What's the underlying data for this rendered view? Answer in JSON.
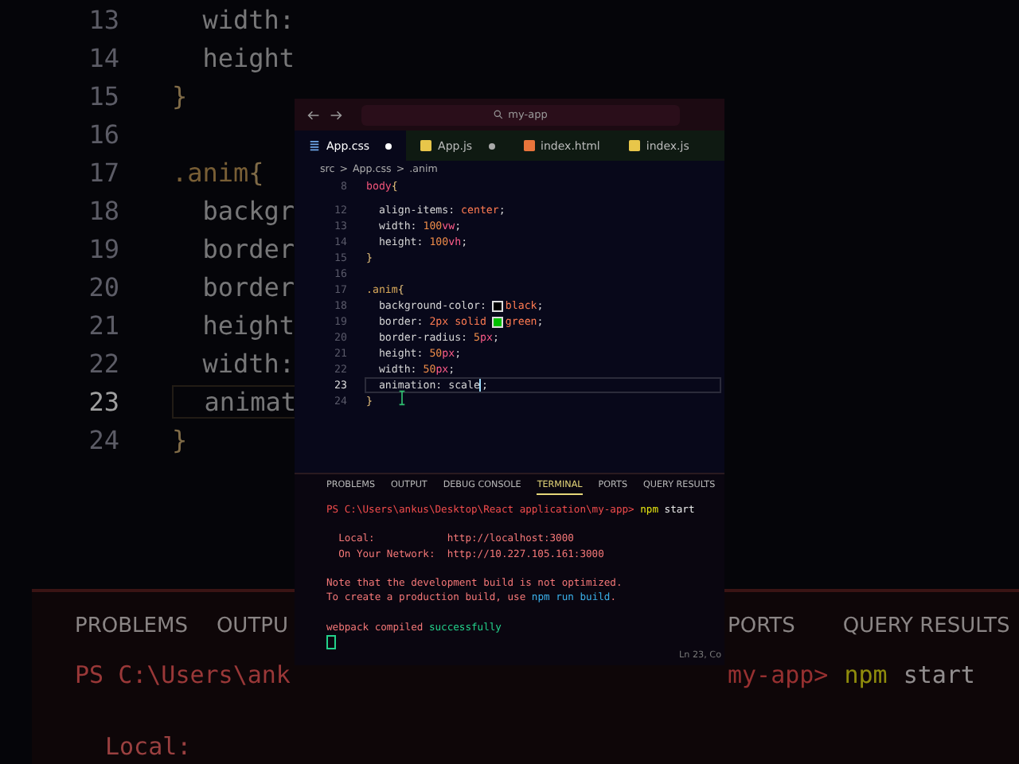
{
  "backdrop": {
    "code_lines": [
      {
        "number": "13",
        "current": false,
        "tokens": [
          {
            "text": "  width:",
            "kind": "prop"
          }
        ]
      },
      {
        "number": "14",
        "current": false,
        "tokens": [
          {
            "text": "  height",
            "kind": "prop"
          }
        ]
      },
      {
        "number": "15",
        "current": false,
        "tokens": [
          {
            "text": "}",
            "kind": "brace"
          }
        ]
      },
      {
        "number": "16",
        "current": false
      },
      {
        "number": "17",
        "current": false,
        "tokens": [
          {
            "text": ".anim",
            "kind": "sel"
          },
          {
            "text": "{",
            "kind": "brace"
          }
        ]
      },
      {
        "number": "18",
        "current": false,
        "tokens": [
          {
            "text": "  backgr",
            "kind": "prop"
          }
        ]
      },
      {
        "number": "19",
        "current": false,
        "tokens": [
          {
            "text": "  border",
            "kind": "prop"
          }
        ]
      },
      {
        "number": "20",
        "current": false,
        "tokens": [
          {
            "text": "  border",
            "kind": "prop"
          }
        ]
      },
      {
        "number": "21",
        "current": false,
        "tokens": [
          {
            "text": "  height",
            "kind": "prop"
          }
        ]
      },
      {
        "number": "22",
        "current": false,
        "tokens": [
          {
            "text": "  width:",
            "kind": "prop"
          }
        ]
      },
      {
        "number": "23",
        "current": true,
        "tokens": [
          {
            "text": "  animat",
            "kind": "prop"
          }
        ]
      },
      {
        "number": "24",
        "current": false,
        "tokens": [
          {
            "text": "}",
            "kind": "brace"
          }
        ]
      }
    ],
    "panel": {
      "tabs_left": [
        "PROBLEMS",
        "OUTPU"
      ],
      "tabs_right": [
        "PORTS",
        "QUERY RESULTS"
      ],
      "prompt_left": "PS C:\\Users\\ank",
      "prompt_right": [
        {
          "text": "my-app>",
          "kind": "path"
        },
        {
          "text": "npm",
          "kind": "cmd"
        },
        {
          "text": "start",
          "kind": "arg"
        }
      ],
      "local": "Local:"
    }
  },
  "window": {
    "search": "my-app",
    "tabs": [
      {
        "label": "App.css",
        "kind": "css",
        "selected": true,
        "modified": true
      },
      {
        "label": "App.js",
        "kind": "js",
        "selected": false,
        "modified": true
      },
      {
        "label": "index.html",
        "kind": "html",
        "selected": false,
        "modified": false
      },
      {
        "label": "index.js",
        "kind": "js",
        "selected": false,
        "modified": false
      }
    ],
    "breadcrumb": [
      {
        "kind": "item",
        "text": "src"
      },
      {
        "kind": "separator",
        "text": ">"
      },
      {
        "kind": "item",
        "text": "App.css"
      },
      {
        "kind": "separator",
        "text": ">"
      },
      {
        "kind": "item",
        "text": ".anim"
      }
    ],
    "editor_lines": [
      {
        "number": "8",
        "current": false,
        "tokens": [
          {
            "text": "body",
            "kind": "tag"
          },
          {
            "text": "{",
            "kind": "brace"
          }
        ]
      },
      {
        "number": "12",
        "current": false,
        "tokens": [
          {
            "text": "  align-items: ",
            "kind": "prop"
          },
          {
            "text": "center",
            "kind": "val"
          },
          {
            "text": ";",
            "kind": "prop"
          }
        ]
      },
      {
        "number": "13",
        "current": false,
        "tokens": [
          {
            "text": "  width: ",
            "kind": "prop"
          },
          {
            "text": "100",
            "kind": "num"
          },
          {
            "text": "vw",
            "kind": "unit"
          },
          {
            "text": ";",
            "kind": "prop"
          }
        ]
      },
      {
        "number": "14",
        "current": false,
        "tokens": [
          {
            "text": "  height: ",
            "kind": "prop"
          },
          {
            "text": "100",
            "kind": "num"
          },
          {
            "text": "vh",
            "kind": "unit"
          },
          {
            "text": ";",
            "kind": "prop"
          }
        ]
      },
      {
        "number": "15",
        "current": false,
        "tokens": [
          {
            "text": "}",
            "kind": "brace"
          }
        ]
      },
      {
        "number": "16",
        "current": false
      },
      {
        "number": "17",
        "current": false,
        "tokens": [
          {
            "text": ".anim",
            "kind": "sel"
          },
          {
            "text": "{",
            "kind": "brace"
          }
        ]
      },
      {
        "number": "18",
        "current": false,
        "tokens": [
          {
            "text": "  background-color: ",
            "kind": "prop"
          },
          {
            "kind": "swatch",
            "color": "#000000"
          },
          {
            "text": "black",
            "kind": "val"
          },
          {
            "text": ";",
            "kind": "prop"
          }
        ]
      },
      {
        "number": "19",
        "current": false,
        "tokens": [
          {
            "text": "  border: ",
            "kind": "prop"
          },
          {
            "text": "2px solid ",
            "kind": "val"
          },
          {
            "kind": "swatch",
            "color": "#00c000"
          },
          {
            "text": "green",
            "kind": "val"
          },
          {
            "text": ";",
            "kind": "prop"
          }
        ]
      },
      {
        "number": "20",
        "current": false,
        "tokens": [
          {
            "text": "  border-radius: ",
            "kind": "prop"
          },
          {
            "text": "5",
            "kind": "num"
          },
          {
            "text": "px",
            "kind": "unit"
          },
          {
            "text": ";",
            "kind": "prop"
          }
        ]
      },
      {
        "number": "21",
        "current": false,
        "tokens": [
          {
            "text": "  height: ",
            "kind": "prop"
          },
          {
            "text": "50",
            "kind": "num"
          },
          {
            "text": "px",
            "kind": "unit"
          },
          {
            "text": ";",
            "kind": "prop"
          }
        ]
      },
      {
        "number": "22",
        "current": false,
        "tokens": [
          {
            "text": "  width: ",
            "kind": "prop"
          },
          {
            "text": "50",
            "kind": "num"
          },
          {
            "text": "px",
            "kind": "unit"
          },
          {
            "text": ";",
            "kind": "prop"
          }
        ]
      },
      {
        "number": "23",
        "current": true,
        "tokens": [
          {
            "text": "  animation: scale",
            "kind": "prop"
          },
          {
            "kind": "caret"
          },
          {
            "text": ";",
            "kind": "prop"
          }
        ]
      },
      {
        "number": "24",
        "current": false,
        "tokens": [
          {
            "text": "}",
            "kind": "brace"
          }
        ]
      }
    ],
    "panel": {
      "tabs": [
        {
          "label": "PROBLEMS",
          "selected": false
        },
        {
          "label": "OUTPUT",
          "selected": false
        },
        {
          "label": "DEBUG CONSOLE",
          "selected": false
        },
        {
          "label": "TERMINAL",
          "selected": true
        },
        {
          "label": "PORTS",
          "selected": false
        },
        {
          "label": "QUERY RESULTS",
          "selected": false
        }
      ],
      "terminal_lines": [
        {
          "kind": "text",
          "segments": [
            {
              "text": "PS C:\\Users\\ankus\\Desktop\\React application\\my-app> ",
              "kind": "path"
            },
            {
              "text": "npm",
              "kind": "cmd"
            },
            {
              "text": " start",
              "kind": "arg"
            }
          ]
        },
        {
          "kind": "blank"
        },
        {
          "kind": "text",
          "segments": [
            {
              "text": "  Local:            http://localhost:3000",
              "kind": "err"
            }
          ]
        },
        {
          "kind": "text",
          "segments": [
            {
              "text": "  On Your Network:  http://10.227.105.161:3000",
              "kind": "err"
            }
          ]
        },
        {
          "kind": "blank"
        },
        {
          "kind": "text",
          "segments": [
            {
              "text": "Note that the development build is not optimized.",
              "kind": "err"
            }
          ]
        },
        {
          "kind": "text",
          "segments": [
            {
              "text": "To create a production build, use ",
              "kind": "err"
            },
            {
              "text": "npm run build",
              "kind": "link"
            },
            {
              "text": ".",
              "kind": "err"
            }
          ]
        },
        {
          "kind": "blank"
        },
        {
          "kind": "text",
          "segments": [
            {
              "text": "webpack compiled ",
              "kind": "err"
            },
            {
              "text": "successfully",
              "kind": "ok"
            }
          ]
        },
        {
          "kind": "cursor"
        }
      ],
      "status": "Ln 23, Co"
    }
  }
}
